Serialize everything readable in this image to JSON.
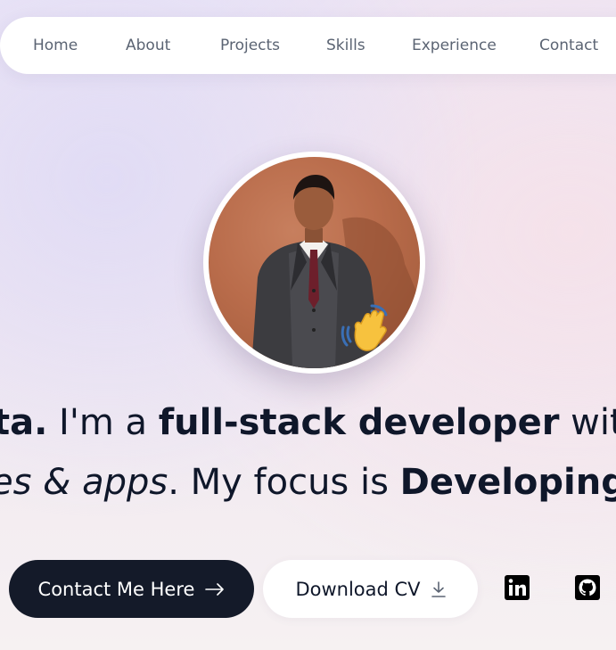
{
  "nav": {
    "items": [
      "Home",
      "About",
      "Projects",
      "Skills",
      "Experience",
      "Contact"
    ]
  },
  "profile": {
    "photo_icon": "portrait-photo",
    "wave_icon": "waving-hand-icon"
  },
  "intro": {
    "line1": [
      {
        "text": "ta.",
        "style": "bold"
      },
      {
        "text": " I'm a ",
        "style": "normal"
      },
      {
        "text": "full-stack developer",
        "style": "bold"
      },
      {
        "text": " with",
        "style": "normal"
      }
    ],
    "line2": [
      {
        "text": "es & apps",
        "style": "italic"
      },
      {
        "text": ". My focus is ",
        "style": "normal"
      },
      {
        "text": "Developing",
        "style": "bold"
      }
    ]
  },
  "actions": {
    "contact_label": "Contact Me Here",
    "cv_label": "Download CV"
  },
  "social": {
    "linkedin_icon": "linkedin-icon",
    "github_icon": "github-icon"
  },
  "colors": {
    "primary_dark": "#141a29",
    "nav_text": "#5b6473",
    "text": "#0f172a"
  }
}
